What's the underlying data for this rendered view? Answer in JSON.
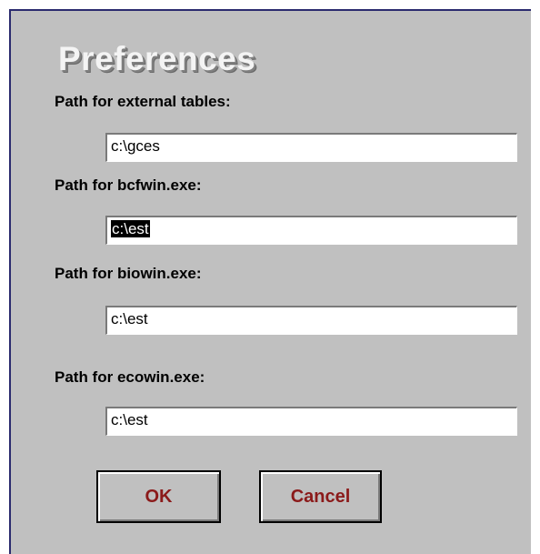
{
  "dialog": {
    "title": "Preferences"
  },
  "fields": [
    {
      "label": "Path for external tables:",
      "value": "c:\\gces",
      "selected": false
    },
    {
      "label": "Path for bcfwin.exe:",
      "value": "c:\\est",
      "selected": true
    },
    {
      "label": "Path for biowin.exe:",
      "value": "c:\\est",
      "selected": false
    },
    {
      "label": "Path for ecowin.exe:",
      "value": "c:\\est",
      "selected": false
    }
  ],
  "buttons": {
    "ok_label": "OK",
    "cancel_label": "Cancel"
  },
  "colors": {
    "dialog_bg": "#c0c0c0",
    "button_text": "#8b1a1a",
    "selection_bg": "#000000"
  }
}
